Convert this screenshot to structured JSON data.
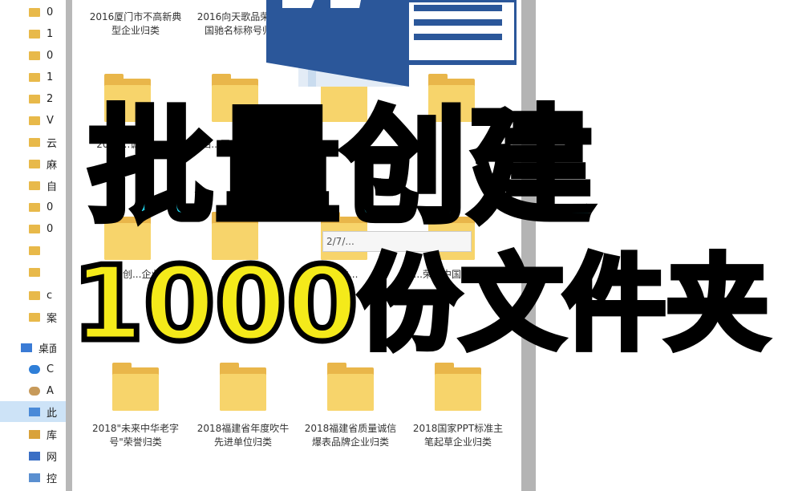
{
  "sidebar": {
    "items": [
      {
        "label": "0",
        "icon": "folder-icon"
      },
      {
        "label": "1",
        "icon": "folder-icon"
      },
      {
        "label": "0",
        "icon": "folder-icon"
      },
      {
        "label": "1",
        "icon": "folder-icon"
      },
      {
        "label": "2",
        "icon": "folder-icon"
      },
      {
        "label": "V",
        "icon": "folder-icon"
      },
      {
        "label": "云",
        "icon": "folder-icon"
      },
      {
        "label": "麻",
        "icon": "folder-icon"
      },
      {
        "label": "自",
        "icon": "folder-icon"
      },
      {
        "label": "0",
        "icon": "folder-icon"
      },
      {
        "label": "0",
        "icon": "folder-icon"
      },
      {
        "label": "",
        "icon": "folder-icon"
      },
      {
        "label": "",
        "icon": "folder-icon"
      },
      {
        "label": "c",
        "icon": "folder-icon"
      },
      {
        "label": "案",
        "icon": "folder-icon"
      },
      {
        "label": "桌面",
        "icon": "desktop-icon"
      },
      {
        "label": "C",
        "icon": "onedrive-icon"
      },
      {
        "label": "A",
        "icon": "user-icon"
      },
      {
        "label": "此",
        "icon": "this-pc-icon"
      },
      {
        "label": "库",
        "icon": "library-icon"
      },
      {
        "label": "网",
        "icon": "network-icon"
      },
      {
        "label": "控",
        "icon": "control-panel-icon"
      }
    ]
  },
  "folders": {
    "r1": [
      "2016厦门市不高新典型企业归类",
      "2016向天歌品荣获中国驰名标称号归类",
      "",
      ""
    ],
    "r2": [
      "2017...诚信...",
      "...四...图草企...归类",
      "",
      ""
    ],
    "r3": [
      "...年度...创...企业...",
      "...型...",
      "...缺...",
      "...荣获中国...标称号..."
    ],
    "r4": [
      "2018\"未来中华老字号\"荣誉归类",
      "2018福建省年度吹牛先进单位归类",
      "2018福建省质量诚信爆表品牌企业归类",
      "2018国家PPT标准主笔起草企业归类"
    ]
  },
  "tooltip": {
    "text": "2/7/..."
  },
  "overlay": {
    "line1": "批量创建",
    "line2": "1000份文件夹"
  },
  "colors": {
    "title_fill": "#22d8f0",
    "subtitle_fill": "#f4ea1a",
    "word_blue": "#2b579a"
  }
}
